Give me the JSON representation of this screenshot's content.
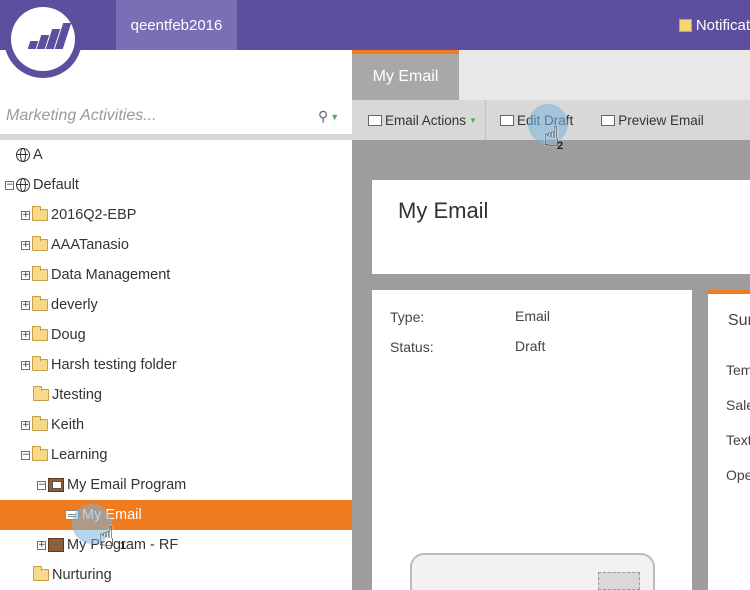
{
  "header": {
    "workspace": "qeentfeb2016",
    "notifications": "Notificat"
  },
  "sidebar": {
    "search_placeholder": "Marketing Activities...",
    "tree": [
      {
        "label": "A",
        "icon": "globe-icon",
        "expander": ""
      },
      {
        "label": "Default",
        "icon": "globe-icon",
        "expander": "−"
      },
      {
        "label": "2016Q2-EBP",
        "icon": "folder-icon",
        "expander": "+"
      },
      {
        "label": "AAATanasio",
        "icon": "folder-icon",
        "expander": "+"
      },
      {
        "label": "Data Management",
        "icon": "folder-icon",
        "expander": "+"
      },
      {
        "label": "deverly",
        "icon": "folder-icon",
        "expander": "+"
      },
      {
        "label": "Doug",
        "icon": "folder-icon",
        "expander": "+"
      },
      {
        "label": "Harsh testing folder",
        "icon": "folder-icon",
        "expander": "+"
      },
      {
        "label": "Jtesting",
        "icon": "folder-icon",
        "expander": ""
      },
      {
        "label": "Keith",
        "icon": "folder-icon",
        "expander": "+"
      },
      {
        "label": "Learning",
        "icon": "folder-icon",
        "expander": "−"
      },
      {
        "label": "My Email Program",
        "icon": "email-program-icon",
        "expander": "−"
      },
      {
        "label": "My Email",
        "icon": "email-icon",
        "expander": "",
        "selected": true
      },
      {
        "label": "My Program - RF",
        "icon": "program-icon",
        "expander": "+"
      },
      {
        "label": "Nurturing",
        "icon": "folder-icon",
        "expander": ""
      }
    ]
  },
  "main": {
    "tab_label": "My Email",
    "toolbar": {
      "email_actions": "Email Actions",
      "edit_draft": "Edit Draft",
      "preview_email": "Preview Email"
    },
    "title": "My Email",
    "info": {
      "type_label": "Type:",
      "type_value": "Email",
      "status_label": "Status:",
      "status_value": "Draft"
    },
    "summary": {
      "heading": "Sur",
      "rows": [
        "Tem",
        "Sale",
        "Text",
        "Ope"
      ]
    }
  },
  "annotations": {
    "step1": "1",
    "step2": "2"
  },
  "colors": {
    "header": "#5b4f9e",
    "accent": "#f07c1f",
    "selected_row": "#f07c1f"
  }
}
